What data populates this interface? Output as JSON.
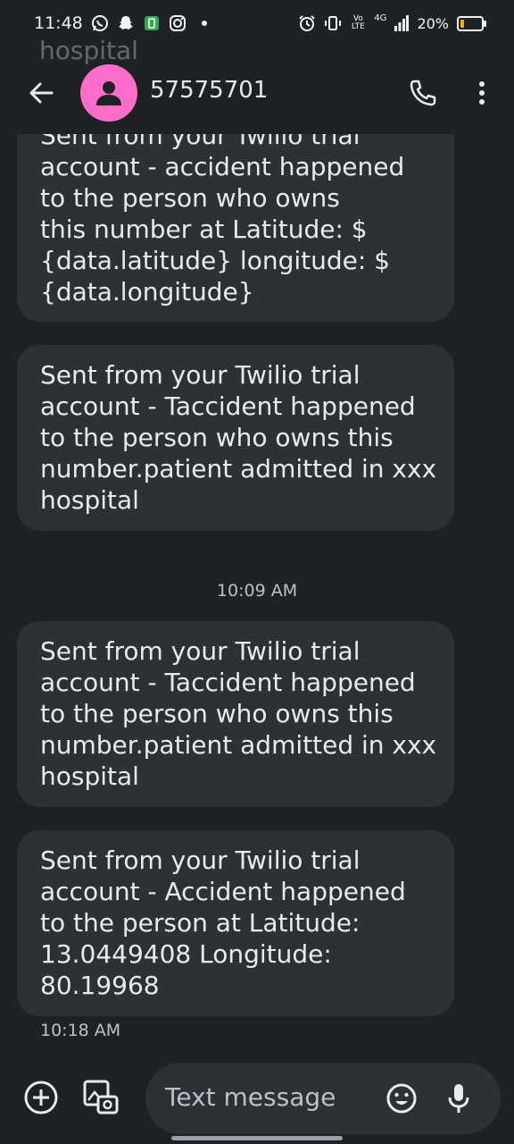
{
  "status_bar": {
    "time": "11:48",
    "battery": "20%",
    "network": "4G",
    "volte": "Vo LTE",
    "battery_level": 0.2,
    "icons": [
      "whatsapp-icon",
      "snapchat-icon",
      "battery-saver-icon",
      "instagram-icon",
      "alarm-icon",
      "vibrate-icon",
      "signal-icon",
      "battery-icon"
    ]
  },
  "background_ghost_text": "hospital",
  "header": {
    "contact": "57575701",
    "avatar_color": "#ff6dcb",
    "icons": [
      "back-arrow-icon",
      "person-icon",
      "phone-icon",
      "more-vert-icon"
    ]
  },
  "messages": [
    {
      "lines": [
        "Sent from your Twilio trial",
        "account - accident happened",
        "to the person who owns",
        "this number at Latitude: $",
        "{data.latitude} longitude: $",
        "{data.longitude}"
      ]
    },
    {
      "lines": [
        "Sent from your Twilio trial",
        "account - Taccident happened",
        "to the person who owns this",
        "number.patient admitted in xxx",
        "hospital"
      ]
    },
    {
      "lines": [
        "Sent from your Twilio trial",
        "account - Taccident happened",
        "to the person who owns this",
        "number.patient admitted in xxx",
        "hospital"
      ]
    },
    {
      "lines": [
        "Sent from your Twilio trial",
        "account - Accident happened",
        "to the person at Latitude:",
        "13.0449408 Longitude:",
        "80.19968"
      ]
    }
  ],
  "timestamps": {
    "divider": "10:09 AM",
    "last_message": "10:18 AM"
  },
  "compose": {
    "placeholder": "Text message",
    "icons": [
      "add-circle-icon",
      "gallery-icon",
      "emoji-icon",
      "mic-icon"
    ]
  },
  "colors": {
    "background": "#202124",
    "bubble": "#2f3033",
    "text": "#e8eaed",
    "accent_avatar": "#ff6dcb",
    "battery_low": "#f9ab00"
  }
}
